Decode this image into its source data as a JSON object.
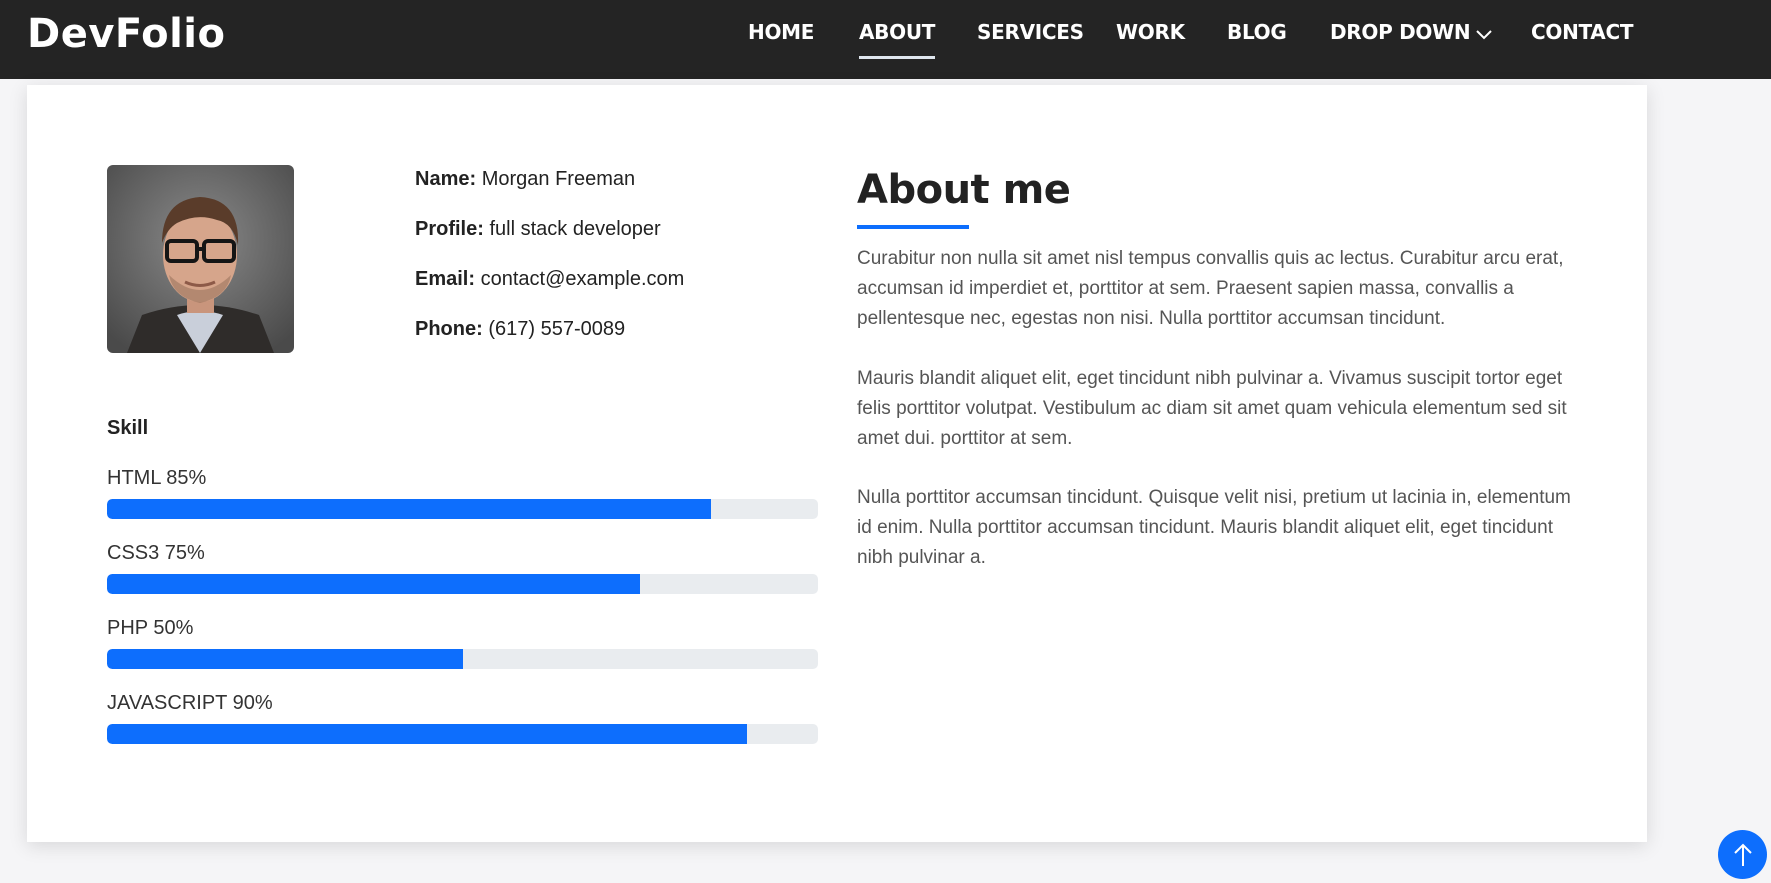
{
  "brand": "DevFolio",
  "nav": {
    "home": "HOME",
    "about": "ABOUT",
    "services": "SERVICES",
    "work": "WORK",
    "blog": "BLOG",
    "dropdown": "DROP DOWN",
    "contact": "CONTACT",
    "active": "about"
  },
  "profile": {
    "name_label": "Name:",
    "name": "Morgan Freeman",
    "profile_label": "Profile:",
    "profile": "full stack developer",
    "email_label": "Email:",
    "email": "contact@example.com",
    "phone_label": "Phone:",
    "phone": "(617) 557-0089"
  },
  "skills": {
    "title": "Skill",
    "items": [
      {
        "label": "HTML 85%",
        "value": 85
      },
      {
        "label": "CSS3 75%",
        "value": 75
      },
      {
        "label": "PHP 50%",
        "value": 50
      },
      {
        "label": "JAVASCRIPT 90%",
        "value": 90
      }
    ]
  },
  "about": {
    "title": "About me",
    "paragraphs": [
      "Curabitur non nulla sit amet nisl tempus convallis quis ac lectus. Curabitur arcu erat, accumsan id imperdiet et, porttitor at sem. Praesent sapien massa, convallis a pellentesque nec, egestas non nisi. Nulla porttitor accumsan tincidunt.",
      "Mauris blandit aliquet elit, eget tincidunt nibh pulvinar a. Vivamus suscipit tortor eget felis porttitor volutpat. Vestibulum ac diam sit amet quam vehicula elementum sed sit amet dui. porttitor at sem.",
      "Nulla porttitor accumsan tincidunt. Quisque velit nisi, pretium ut lacinia in, elementum id enim. Nulla porttitor accumsan tincidunt. Mauris blandit aliquet elit, eget tincidunt nibh pulvinar a."
    ]
  },
  "colors": {
    "accent": "#0d6efd",
    "topbar": "#242424",
    "track": "#e9ecef"
  },
  "icons": {
    "dropdown": "chevron-down-icon",
    "back_to_top": "arrow-up-icon"
  }
}
